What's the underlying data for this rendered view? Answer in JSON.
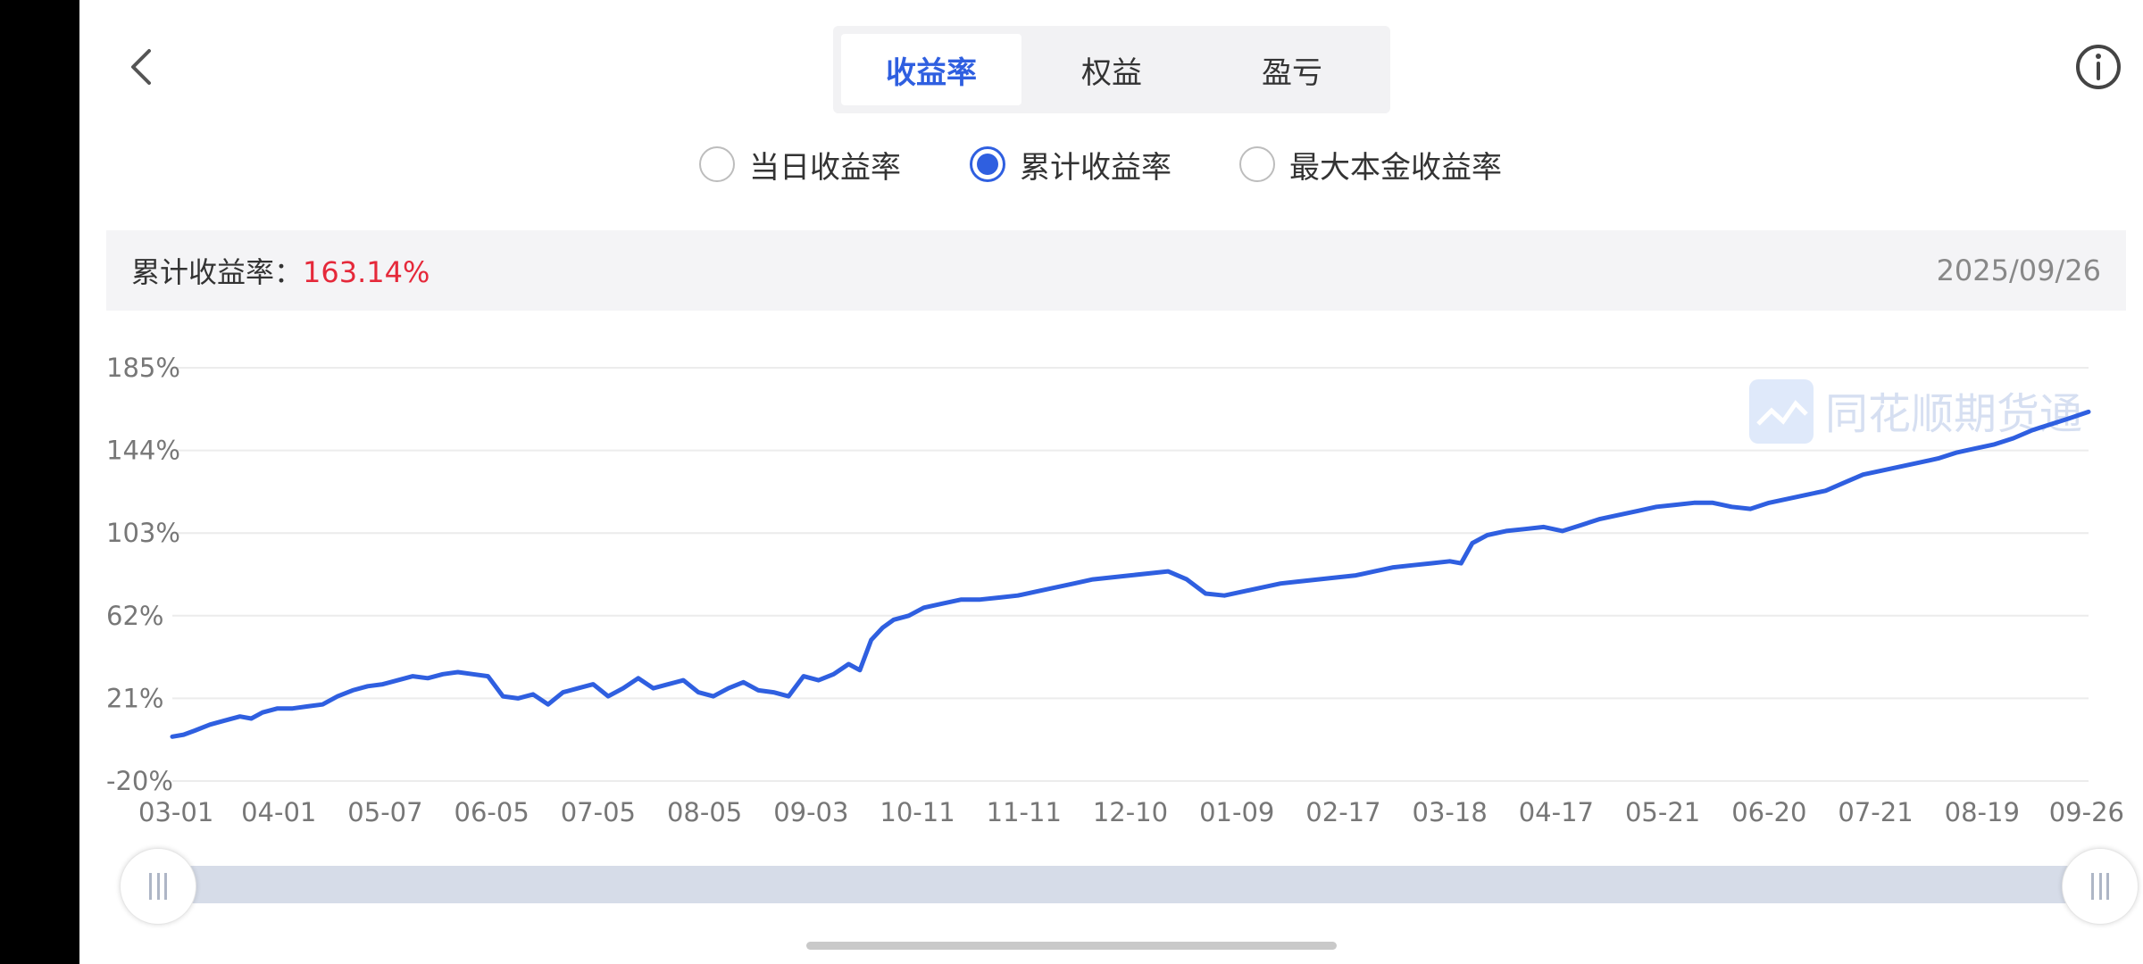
{
  "tabs": [
    {
      "label": "收益率",
      "active": true
    },
    {
      "label": "权益",
      "active": false
    },
    {
      "label": "盈亏",
      "active": false
    }
  ],
  "radios": [
    {
      "label": "当日收益率",
      "checked": false
    },
    {
      "label": "累计收益率",
      "checked": true
    },
    {
      "label": "最大本金收益率",
      "checked": false
    }
  ],
  "summary": {
    "label": "累计收益率：",
    "value": "163.14%",
    "date": "2025/09/26"
  },
  "watermark": "同花顺期货通",
  "colors": {
    "accent": "#2f5fe0",
    "line": "#2f5fe0",
    "value_red": "#e5293a",
    "track": "#d6dce8"
  },
  "icons": {
    "back": "chevron-left-icon",
    "info": "info-icon"
  },
  "chart_data": {
    "type": "line",
    "title": "",
    "xlabel": "",
    "ylabel": "",
    "y_ticks": [
      "185%",
      "144%",
      "103%",
      "62%",
      "21%",
      "-20%"
    ],
    "ylim": [
      -20,
      185
    ],
    "x_ticks": [
      "03-01",
      "04-01",
      "05-07",
      "06-05",
      "07-05",
      "08-05",
      "09-03",
      "10-11",
      "11-11",
      "12-10",
      "01-09",
      "02-17",
      "03-18",
      "04-17",
      "05-21",
      "06-20",
      "07-21",
      "08-19",
      "09-26"
    ],
    "grid": true,
    "series": [
      {
        "values": [
          [
            0,
            2
          ],
          [
            0.3,
            3
          ],
          [
            0.6,
            5
          ],
          [
            1.0,
            8
          ],
          [
            1.4,
            10
          ],
          [
            1.8,
            12
          ],
          [
            2.1,
            11
          ],
          [
            2.4,
            14
          ],
          [
            2.8,
            16
          ],
          [
            3.2,
            16
          ],
          [
            3.6,
            17
          ],
          [
            4.0,
            18
          ],
          [
            4.4,
            22
          ],
          [
            4.8,
            25
          ],
          [
            5.2,
            27
          ],
          [
            5.6,
            28
          ],
          [
            6.0,
            30
          ],
          [
            6.4,
            32
          ],
          [
            6.8,
            31
          ],
          [
            7.2,
            33
          ],
          [
            7.6,
            34
          ],
          [
            8.0,
            33
          ],
          [
            8.4,
            32
          ],
          [
            8.8,
            22
          ],
          [
            9.2,
            21
          ],
          [
            9.6,
            23
          ],
          [
            10.0,
            18
          ],
          [
            10.4,
            24
          ],
          [
            10.8,
            26
          ],
          [
            11.2,
            28
          ],
          [
            11.6,
            22
          ],
          [
            12.0,
            26
          ],
          [
            12.4,
            31
          ],
          [
            12.8,
            26
          ],
          [
            13.2,
            28
          ],
          [
            13.6,
            30
          ],
          [
            14.0,
            24
          ],
          [
            14.4,
            22
          ],
          [
            14.8,
            26
          ],
          [
            15.2,
            29
          ],
          [
            15.6,
            25
          ],
          [
            16.0,
            24
          ],
          [
            16.4,
            22
          ],
          [
            16.8,
            32
          ],
          [
            17.2,
            30
          ],
          [
            17.6,
            33
          ],
          [
            18.0,
            38
          ],
          [
            18.3,
            35
          ],
          [
            18.6,
            50
          ],
          [
            18.9,
            56
          ],
          [
            19.2,
            60
          ],
          [
            19.6,
            62
          ],
          [
            20.0,
            66
          ],
          [
            20.5,
            68
          ],
          [
            21.0,
            70
          ],
          [
            21.5,
            70
          ],
          [
            22.0,
            71
          ],
          [
            22.5,
            72
          ],
          [
            23.0,
            74
          ],
          [
            23.5,
            76
          ],
          [
            24.0,
            78
          ],
          [
            24.5,
            80
          ],
          [
            25.0,
            81
          ],
          [
            25.5,
            82
          ],
          [
            26.0,
            83
          ],
          [
            26.5,
            84
          ],
          [
            27.0,
            80
          ],
          [
            27.5,
            73
          ],
          [
            28.0,
            72
          ],
          [
            28.5,
            74
          ],
          [
            29.0,
            76
          ],
          [
            29.5,
            78
          ],
          [
            30.0,
            79
          ],
          [
            30.5,
            80
          ],
          [
            31.0,
            81
          ],
          [
            31.5,
            82
          ],
          [
            32.0,
            84
          ],
          [
            32.5,
            86
          ],
          [
            33.0,
            87
          ],
          [
            33.5,
            88
          ],
          [
            34.0,
            89
          ],
          [
            34.3,
            88
          ],
          [
            34.6,
            98
          ],
          [
            35.0,
            102
          ],
          [
            35.5,
            104
          ],
          [
            36.0,
            105
          ],
          [
            36.5,
            106
          ],
          [
            37.0,
            104
          ],
          [
            37.5,
            107
          ],
          [
            38.0,
            110
          ],
          [
            38.5,
            112
          ],
          [
            39.0,
            114
          ],
          [
            39.5,
            116
          ],
          [
            40.0,
            117
          ],
          [
            40.5,
            118
          ],
          [
            41.0,
            118
          ],
          [
            41.5,
            116
          ],
          [
            42.0,
            115
          ],
          [
            42.5,
            118
          ],
          [
            43.0,
            120
          ],
          [
            43.5,
            122
          ],
          [
            44.0,
            124
          ],
          [
            44.5,
            128
          ],
          [
            45.0,
            132
          ],
          [
            45.5,
            134
          ],
          [
            46.0,
            136
          ],
          [
            46.5,
            138
          ],
          [
            47.0,
            140
          ],
          [
            47.5,
            143
          ],
          [
            48.0,
            145
          ],
          [
            48.5,
            147
          ],
          [
            49.0,
            150
          ],
          [
            49.5,
            154
          ],
          [
            50.0,
            157
          ],
          [
            50.5,
            160
          ],
          [
            51.0,
            163.14
          ]
        ]
      }
    ]
  }
}
